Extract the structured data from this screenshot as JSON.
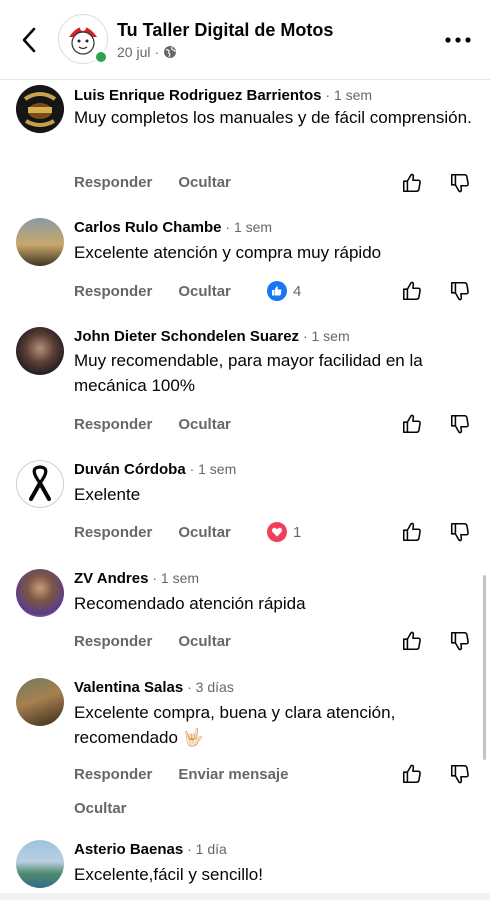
{
  "header": {
    "title": "Tu Taller Digital de Motos",
    "date": "20 jul",
    "separator": "·"
  },
  "comments": [
    {
      "name": "Luis Enrique Rodriguez Barrientos",
      "time": " · 1 sem",
      "text": "Muy completos los manuales y de fácil comprensión.",
      "actions": [
        "Responder",
        "Ocultar"
      ],
      "reaction": null
    },
    {
      "name": "Carlos Rulo Chambe",
      "time": " · 1 sem",
      "text": "Excelente atención y compra muy rápido",
      "actions": [
        "Responder",
        "Ocultar"
      ],
      "reaction": {
        "type": "like",
        "count": "4",
        "color": "#1877f2"
      }
    },
    {
      "name": "John Dieter Schondelen Suarez",
      "time": " · 1 sem",
      "text": "Muy recomendable, para mayor facilidad en la mecánica 100%",
      "actions": [
        "Responder",
        "Ocultar"
      ],
      "reaction": null
    },
    {
      "name": "Duván Córdoba",
      "time": " · 1 sem",
      "text": "Exelente",
      "actions": [
        "Responder",
        "Ocultar"
      ],
      "reaction": {
        "type": "love",
        "count": "1",
        "color": "#f33e58"
      }
    },
    {
      "name": "ZV Andres",
      "time": " · 1 sem",
      "text": "Recomendado atención rápida",
      "actions": [
        "Responder",
        "Ocultar"
      ],
      "reaction": null
    },
    {
      "name": "Valentina Salas",
      "time": " · 3 días",
      "text": "Excelente compra, buena y clara atención, recomendado 🤟🏻",
      "actions": [
        "Responder",
        "Enviar mensaje"
      ],
      "extra_action": "Ocultar",
      "reaction": null
    },
    {
      "name": "Asterio Baenas",
      "time": " · 1 día",
      "text": "Excelente,fácil y sencillo!",
      "actions": [],
      "reaction": null
    }
  ],
  "icons": {
    "back": "chevron-left-icon",
    "globe": "globe-icon",
    "more": "more-dots-icon",
    "like": "thumbs-up-icon",
    "dislike": "thumbs-down-icon"
  }
}
